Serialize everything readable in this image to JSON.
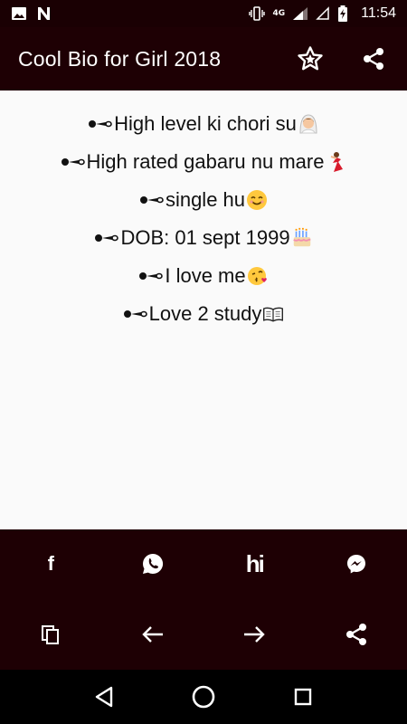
{
  "status_bar": {
    "time": "11:54",
    "network": "4G",
    "icons": [
      "image-icon",
      "n-notification-icon",
      "vibrate-icon",
      "signal-icon",
      "no-sim-icon",
      "battery-charging-icon"
    ]
  },
  "app_bar": {
    "title": "Cool Bio for Girl 2018",
    "actions": [
      "star-icon",
      "share-icon"
    ]
  },
  "bio_lines": [
    {
      "text": "High level ki chori su",
      "emoji": "bride-icon"
    },
    {
      "text": "High rated gabaru nu mare",
      "emoji": "dancer-icon"
    },
    {
      "text": "single hu",
      "emoji": "smile-icon"
    },
    {
      "text": "DOB: 01 sept 1999",
      "emoji": "cake-icon"
    },
    {
      "text": "I love me",
      "emoji": "kiss-icon"
    },
    {
      "text": "Love 2 study",
      "emoji": "book-icon"
    }
  ],
  "share_bar": {
    "row1": [
      "facebook-icon",
      "whatsapp-icon",
      "hike-icon",
      "messenger-icon"
    ],
    "row2": [
      "copy-icon",
      "arrow-left-icon",
      "arrow-right-icon",
      "share-icon"
    ],
    "facebook_glyph": "f",
    "hike_glyph": "hi"
  },
  "nav_bar": [
    "back-icon",
    "home-icon",
    "recents-icon"
  ],
  "colors": {
    "bar_bg": "#1e0004",
    "content_bg": "#fafafa",
    "text": "#111111",
    "icon": "#ffffff"
  }
}
